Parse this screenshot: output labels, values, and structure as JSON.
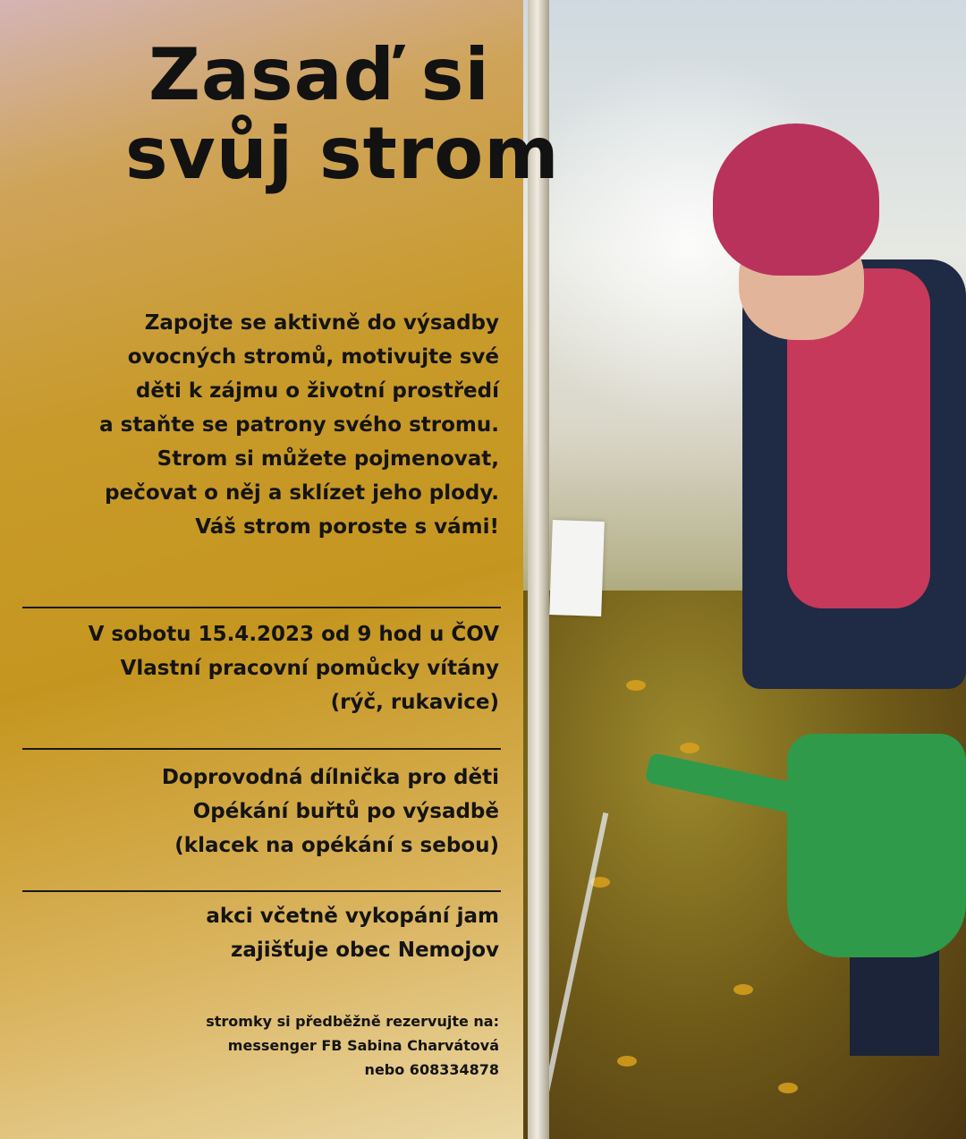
{
  "title": {
    "line1": "Zasaď si",
    "line2": "svůj strom"
  },
  "intro": {
    "lines": [
      "Zapojte se aktivně do výsadby",
      "ovocných stromů, motivujte své",
      "děti k zájmu o životní prostředí",
      "a staňte se patrony svého stromu.",
      "Strom si můžete pojmenovat,",
      "pečovat o něj a sklízet jeho plody.",
      "Váš strom poroste s vámi!"
    ]
  },
  "event": {
    "lines": [
      "V sobotu 15.4.2023 od 9 hod u ČOV",
      "Vlastní pracovní pomůcky vítány",
      "(rýč, rukavice)"
    ]
  },
  "extras": {
    "lines": [
      "Doprovodná dílnička pro děti",
      "Opékání buřtů po výsadbě",
      "(klacek na opékání s sebou)"
    ]
  },
  "organizer": {
    "lines": [
      "akci včetně vykopání jam",
      "zajišťuje obec Nemojov"
    ]
  },
  "reservation": {
    "lines": [
      "stromky si předběžně rezervujte na:",
      "messenger FB Sabina Charvátová",
      "nebo 608334878"
    ]
  },
  "colors": {
    "panel_gold": "#c5961f",
    "text": "#141414"
  }
}
